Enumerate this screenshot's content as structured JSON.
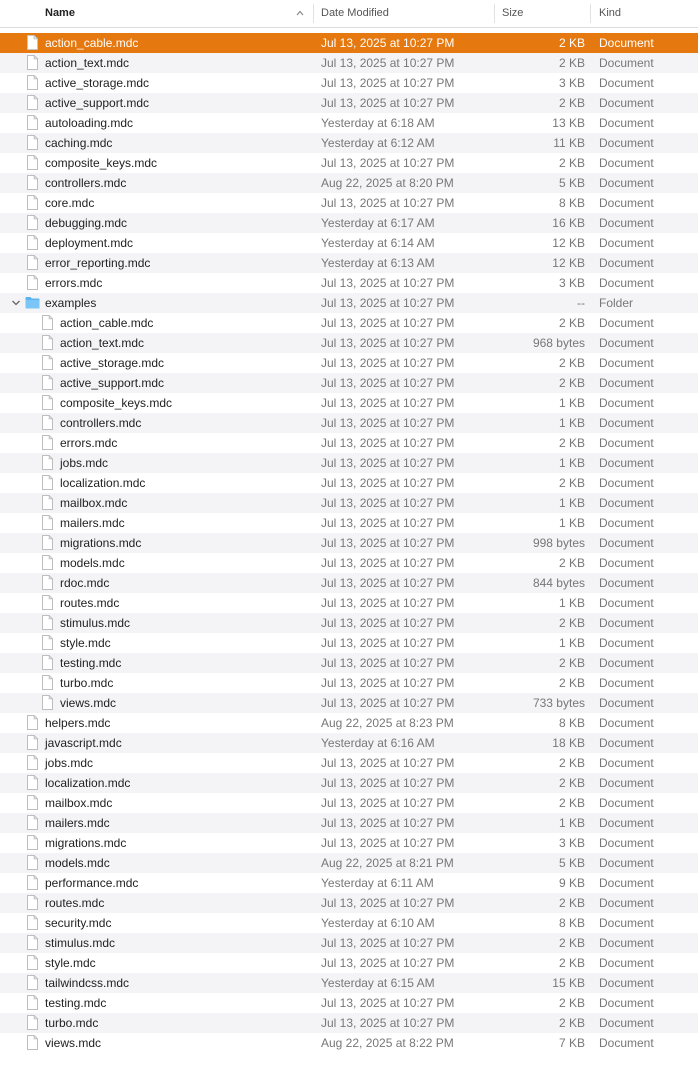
{
  "header": {
    "name": "Name",
    "date": "Date Modified",
    "size": "Size",
    "kind": "Kind"
  },
  "colors": {
    "selection": "#e5780f",
    "stripe": "#f4f4f6",
    "folder": "#5ab4f2"
  },
  "icons": {
    "file": "document-icon",
    "folder": "folder-icon",
    "sort": "chevron-up-icon",
    "disclosure": "chevron-down-icon"
  },
  "rows": [
    {
      "name": "action_cable.mdc",
      "date": "Jul 13, 2025 at 10:27 PM",
      "size": "2 KB",
      "kind": "Document",
      "selected": true
    },
    {
      "name": "action_text.mdc",
      "date": "Jul 13, 2025 at 10:27 PM",
      "size": "2 KB",
      "kind": "Document"
    },
    {
      "name": "active_storage.mdc",
      "date": "Jul 13, 2025 at 10:27 PM",
      "size": "3 KB",
      "kind": "Document"
    },
    {
      "name": "active_support.mdc",
      "date": "Jul 13, 2025 at 10:27 PM",
      "size": "2 KB",
      "kind": "Document"
    },
    {
      "name": "autoloading.mdc",
      "date": "Yesterday at 6:18 AM",
      "size": "13 KB",
      "kind": "Document"
    },
    {
      "name": "caching.mdc",
      "date": "Yesterday at 6:12 AM",
      "size": "11 KB",
      "kind": "Document"
    },
    {
      "name": "composite_keys.mdc",
      "date": "Jul 13, 2025 at 10:27 PM",
      "size": "2 KB",
      "kind": "Document"
    },
    {
      "name": "controllers.mdc",
      "date": "Aug 22, 2025 at 8:20 PM",
      "size": "5 KB",
      "kind": "Document"
    },
    {
      "name": "core.mdc",
      "date": "Jul 13, 2025 at 10:27 PM",
      "size": "8 KB",
      "kind": "Document"
    },
    {
      "name": "debugging.mdc",
      "date": "Yesterday at 6:17 AM",
      "size": "16 KB",
      "kind": "Document"
    },
    {
      "name": "deployment.mdc",
      "date": "Yesterday at 6:14 AM",
      "size": "12 KB",
      "kind": "Document"
    },
    {
      "name": "error_reporting.mdc",
      "date": "Yesterday at 6:13 AM",
      "size": "12 KB",
      "kind": "Document"
    },
    {
      "name": "errors.mdc",
      "date": "Jul 13, 2025 at 10:27 PM",
      "size": "3 KB",
      "kind": "Document"
    },
    {
      "name": "examples",
      "date": "Jul 13, 2025 at 10:27 PM",
      "size": "--",
      "kind": "Folder",
      "folder": true,
      "expanded": true
    },
    {
      "name": "action_cable.mdc",
      "date": "Jul 13, 2025 at 10:27 PM",
      "size": "2 KB",
      "kind": "Document",
      "child": true
    },
    {
      "name": "action_text.mdc",
      "date": "Jul 13, 2025 at 10:27 PM",
      "size": "968 bytes",
      "kind": "Document",
      "child": true
    },
    {
      "name": "active_storage.mdc",
      "date": "Jul 13, 2025 at 10:27 PM",
      "size": "2 KB",
      "kind": "Document",
      "child": true
    },
    {
      "name": "active_support.mdc",
      "date": "Jul 13, 2025 at 10:27 PM",
      "size": "2 KB",
      "kind": "Document",
      "child": true
    },
    {
      "name": "composite_keys.mdc",
      "date": "Jul 13, 2025 at 10:27 PM",
      "size": "1 KB",
      "kind": "Document",
      "child": true
    },
    {
      "name": "controllers.mdc",
      "date": "Jul 13, 2025 at 10:27 PM",
      "size": "1 KB",
      "kind": "Document",
      "child": true
    },
    {
      "name": "errors.mdc",
      "date": "Jul 13, 2025 at 10:27 PM",
      "size": "2 KB",
      "kind": "Document",
      "child": true
    },
    {
      "name": "jobs.mdc",
      "date": "Jul 13, 2025 at 10:27 PM",
      "size": "1 KB",
      "kind": "Document",
      "child": true
    },
    {
      "name": "localization.mdc",
      "date": "Jul 13, 2025 at 10:27 PM",
      "size": "2 KB",
      "kind": "Document",
      "child": true
    },
    {
      "name": "mailbox.mdc",
      "date": "Jul 13, 2025 at 10:27 PM",
      "size": "1 KB",
      "kind": "Document",
      "child": true
    },
    {
      "name": "mailers.mdc",
      "date": "Jul 13, 2025 at 10:27 PM",
      "size": "1 KB",
      "kind": "Document",
      "child": true
    },
    {
      "name": "migrations.mdc",
      "date": "Jul 13, 2025 at 10:27 PM",
      "size": "998 bytes",
      "kind": "Document",
      "child": true
    },
    {
      "name": "models.mdc",
      "date": "Jul 13, 2025 at 10:27 PM",
      "size": "2 KB",
      "kind": "Document",
      "child": true
    },
    {
      "name": "rdoc.mdc",
      "date": "Jul 13, 2025 at 10:27 PM",
      "size": "844 bytes",
      "kind": "Document",
      "child": true
    },
    {
      "name": "routes.mdc",
      "date": "Jul 13, 2025 at 10:27 PM",
      "size": "1 KB",
      "kind": "Document",
      "child": true
    },
    {
      "name": "stimulus.mdc",
      "date": "Jul 13, 2025 at 10:27 PM",
      "size": "2 KB",
      "kind": "Document",
      "child": true
    },
    {
      "name": "style.mdc",
      "date": "Jul 13, 2025 at 10:27 PM",
      "size": "1 KB",
      "kind": "Document",
      "child": true
    },
    {
      "name": "testing.mdc",
      "date": "Jul 13, 2025 at 10:27 PM",
      "size": "2 KB",
      "kind": "Document",
      "child": true
    },
    {
      "name": "turbo.mdc",
      "date": "Jul 13, 2025 at 10:27 PM",
      "size": "2 KB",
      "kind": "Document",
      "child": true
    },
    {
      "name": "views.mdc",
      "date": "Jul 13, 2025 at 10:27 PM",
      "size": "733 bytes",
      "kind": "Document",
      "child": true
    },
    {
      "name": "helpers.mdc",
      "date": "Aug 22, 2025 at 8:23 PM",
      "size": "8 KB",
      "kind": "Document"
    },
    {
      "name": "javascript.mdc",
      "date": "Yesterday at 6:16 AM",
      "size": "18 KB",
      "kind": "Document"
    },
    {
      "name": "jobs.mdc",
      "date": "Jul 13, 2025 at 10:27 PM",
      "size": "2 KB",
      "kind": "Document"
    },
    {
      "name": "localization.mdc",
      "date": "Jul 13, 2025 at 10:27 PM",
      "size": "2 KB",
      "kind": "Document"
    },
    {
      "name": "mailbox.mdc",
      "date": "Jul 13, 2025 at 10:27 PM",
      "size": "2 KB",
      "kind": "Document"
    },
    {
      "name": "mailers.mdc",
      "date": "Jul 13, 2025 at 10:27 PM",
      "size": "1 KB",
      "kind": "Document"
    },
    {
      "name": "migrations.mdc",
      "date": "Jul 13, 2025 at 10:27 PM",
      "size": "3 KB",
      "kind": "Document"
    },
    {
      "name": "models.mdc",
      "date": "Aug 22, 2025 at 8:21 PM",
      "size": "5 KB",
      "kind": "Document"
    },
    {
      "name": "performance.mdc",
      "date": "Yesterday at 6:11 AM",
      "size": "9 KB",
      "kind": "Document"
    },
    {
      "name": "routes.mdc",
      "date": "Jul 13, 2025 at 10:27 PM",
      "size": "2 KB",
      "kind": "Document"
    },
    {
      "name": "security.mdc",
      "date": "Yesterday at 6:10 AM",
      "size": "8 KB",
      "kind": "Document"
    },
    {
      "name": "stimulus.mdc",
      "date": "Jul 13, 2025 at 10:27 PM",
      "size": "2 KB",
      "kind": "Document"
    },
    {
      "name": "style.mdc",
      "date": "Jul 13, 2025 at 10:27 PM",
      "size": "2 KB",
      "kind": "Document"
    },
    {
      "name": "tailwindcss.mdc",
      "date": "Yesterday at 6:15 AM",
      "size": "15 KB",
      "kind": "Document"
    },
    {
      "name": "testing.mdc",
      "date": "Jul 13, 2025 at 10:27 PM",
      "size": "2 KB",
      "kind": "Document"
    },
    {
      "name": "turbo.mdc",
      "date": "Jul 13, 2025 at 10:27 PM",
      "size": "2 KB",
      "kind": "Document"
    },
    {
      "name": "views.mdc",
      "date": "Aug 22, 2025 at 8:22 PM",
      "size": "7 KB",
      "kind": "Document"
    }
  ]
}
